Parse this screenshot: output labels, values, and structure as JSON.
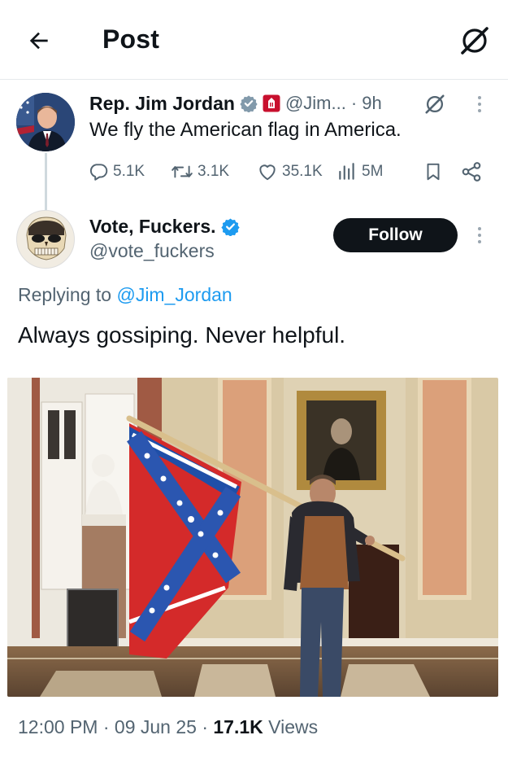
{
  "header": {
    "title": "Post"
  },
  "parent_tweet": {
    "display_name": "Rep. Jim Jordan",
    "handle": "@Jim...",
    "time": "· 9h",
    "text": "We fly the American flag in America.",
    "stats": {
      "replies": "5.1K",
      "retweets": "3.1K",
      "likes": "35.1K",
      "views": "5M"
    }
  },
  "reply_tweet": {
    "display_name": "Vote, Fuckers.",
    "handle": "@vote_fuckers",
    "follow_label": "Follow",
    "replying_prefix": "Replying to ",
    "replying_handle": "@Jim_Jordan",
    "text": "Always gossiping. Never helpful."
  },
  "footer": {
    "time": "12:00 PM",
    "sep1": " · ",
    "date": "09 Jun 25",
    "sep2": " · ",
    "views_count": "17.1K",
    "views_label": " Views"
  },
  "colors": {
    "accent": "#1d9bf0",
    "text": "#0f1419",
    "muted": "#536471",
    "follow_bg": "#0f1419"
  },
  "icons": {
    "back": "arrow-left-icon",
    "grok": "grok-icon",
    "verified": "verified-badge-icon",
    "affiliate": "house-of-representatives-icon",
    "reply": "reply-icon",
    "retweet": "retweet-icon",
    "like": "heart-icon",
    "views": "views-chart-icon",
    "bookmark": "bookmark-icon",
    "share": "share-icon",
    "more": "more-vertical-icon"
  }
}
